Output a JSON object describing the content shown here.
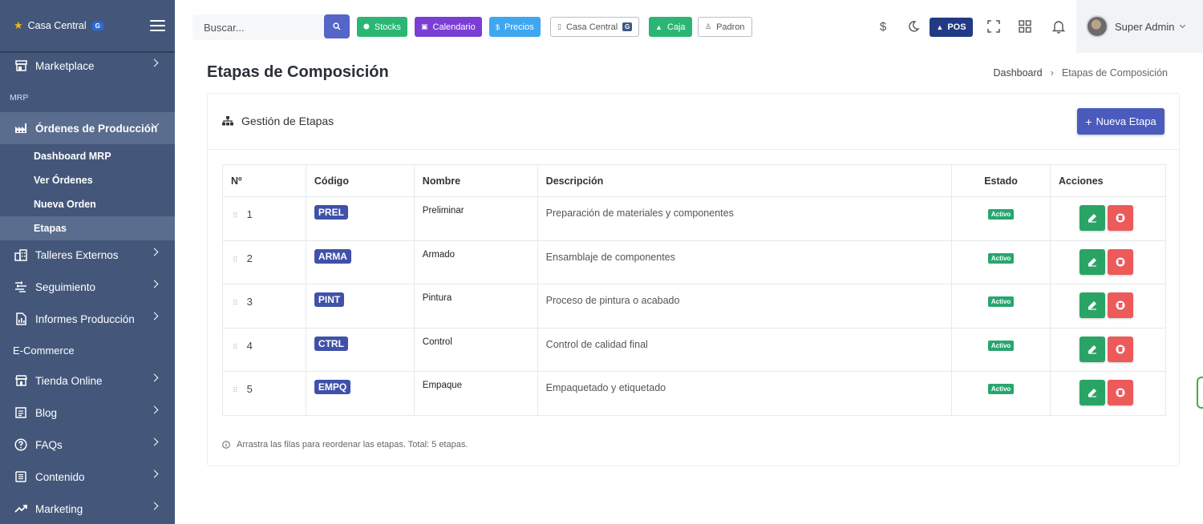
{
  "sidebar": {
    "brand": "Casa Central",
    "brand_badge": "G",
    "items": [
      {
        "label": "Marketplace"
      },
      {
        "label": "Órdenes de Producción"
      },
      {
        "label": "Talleres Externos"
      },
      {
        "label": "Seguimiento"
      },
      {
        "label": "Informes Producción"
      },
      {
        "label": "Tienda Online"
      },
      {
        "label": "Blog"
      },
      {
        "label": "FAQs"
      },
      {
        "label": "Contenido"
      },
      {
        "label": "Marketing"
      }
    ],
    "sections": {
      "mrp": "MRP",
      "ecommerce": "E-Commerce"
    },
    "subitems": [
      "Dashboard MRP",
      "Ver Órdenes",
      "Nueva Orden",
      "Etapas"
    ]
  },
  "topbar": {
    "search_placeholder": "Buscar...",
    "buttons": {
      "stocks": "Stocks",
      "calendario": "Calendario",
      "precios": "Precios",
      "casa_central": "Casa Central",
      "casa_central_badge": "G",
      "caja": "Caja",
      "padron": "Padron"
    },
    "pos": "POS",
    "user": "Super Admin",
    "colors": {
      "stocks": "#2bb673",
      "calendario": "#7a3ed6",
      "precios": "#3fa6f0",
      "caja": "#2bb673"
    }
  },
  "page": {
    "title": "Etapas de Composición",
    "breadcrumb": {
      "home": "Dashboard",
      "current": "Etapas de Composición"
    }
  },
  "card": {
    "title": "Gestión de Etapas",
    "new_button": "Nueva Etapa",
    "columns": {
      "num": "Nº",
      "codigo": "Código",
      "nombre": "Nombre",
      "descripcion": "Descripción",
      "estado": "Estado",
      "acciones": "Acciones"
    },
    "rows": [
      {
        "num": "1",
        "codigo": "PREL",
        "nombre": "Preliminar",
        "descripcion": "Preparación de materiales y componentes",
        "estado": "Activo"
      },
      {
        "num": "2",
        "codigo": "ARMA",
        "nombre": "Armado",
        "descripcion": "Ensamblaje de componentes",
        "estado": "Activo"
      },
      {
        "num": "3",
        "codigo": "PINT",
        "nombre": "Pintura",
        "descripcion": "Proceso de pintura o acabado",
        "estado": "Activo"
      },
      {
        "num": "4",
        "codigo": "CTRL",
        "nombre": "Control",
        "descripcion": "Control de calidad final",
        "estado": "Activo"
      },
      {
        "num": "5",
        "codigo": "EMPQ",
        "nombre": "Empaque",
        "descripcion": "Empaquetado y etiquetado",
        "estado": "Activo"
      }
    ],
    "footer": "Arrastra las filas para reordenar las etapas. Total: 5 etapas."
  }
}
